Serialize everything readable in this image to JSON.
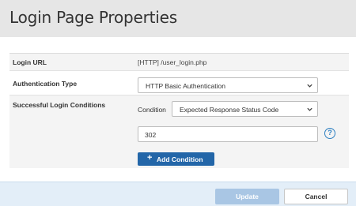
{
  "dialog": {
    "title": "Login Page Properties"
  },
  "fields": {
    "login_url": {
      "label": "Login URL",
      "value": "[HTTP] /user_login.php"
    },
    "auth_type": {
      "label": "Authentication Type",
      "selected": "HTTP Basic Authentication"
    },
    "success_conditions": {
      "label": "Successful Login Conditions",
      "condition_label": "Condition",
      "condition_selected": "Expected Response Status Code",
      "condition_value": "302",
      "help_glyph": "?",
      "add_glyph": "+",
      "add_button": "Add Condition"
    }
  },
  "footer": {
    "update_button": "Update",
    "cancel_button": "Cancel"
  },
  "colors": {
    "titlebar_bg": "#e6e6e6",
    "accent": "#2366a8",
    "update_disabled": "#a9c6e4",
    "footer_bg": "#e3eef8"
  }
}
